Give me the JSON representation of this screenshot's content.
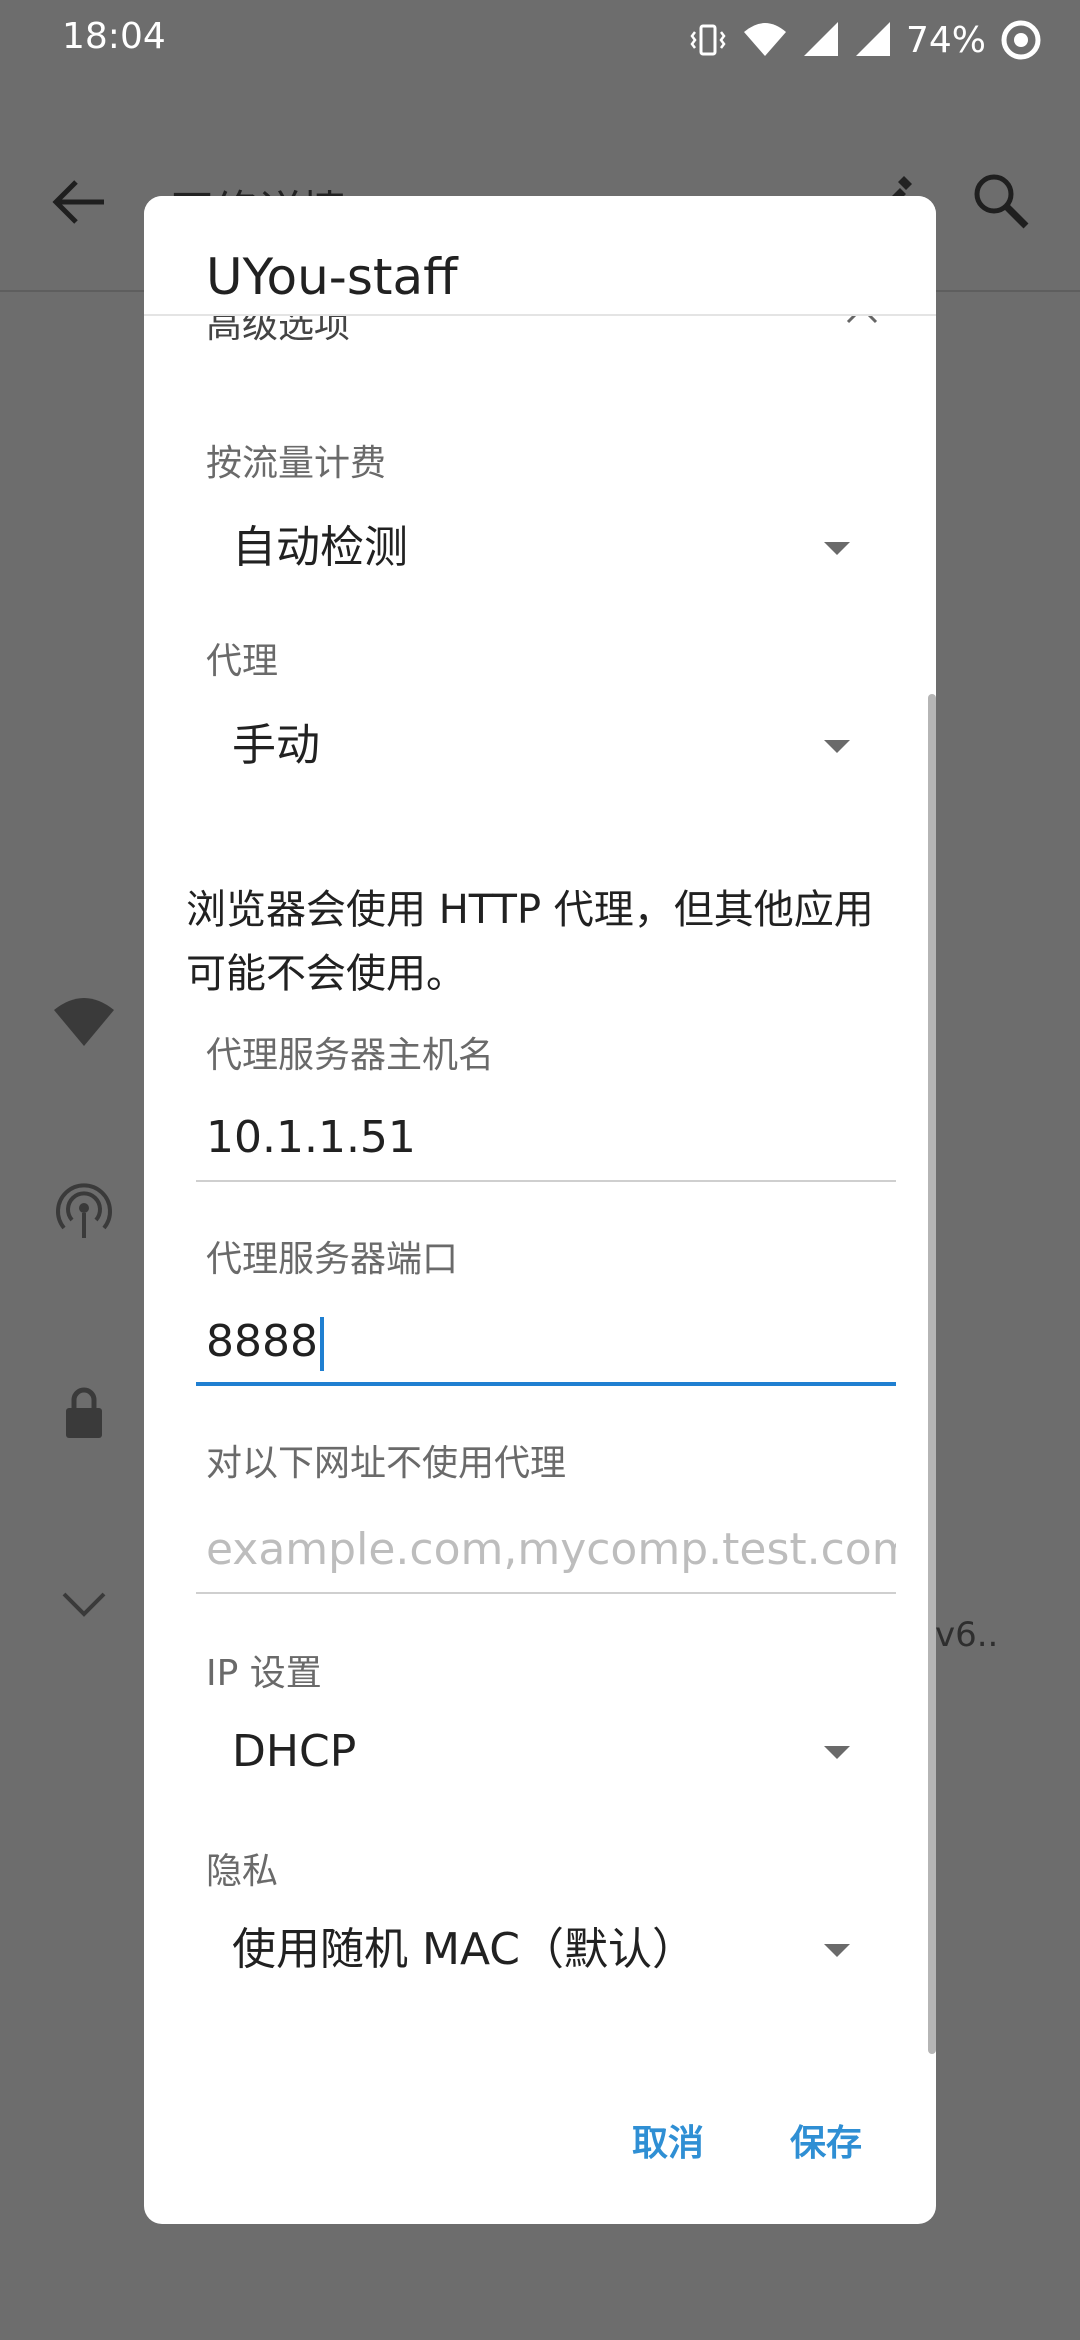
{
  "status_bar": {
    "time": "18:04",
    "battery_percent": "74%",
    "icons": [
      "vibrate-icon",
      "wifi-icon",
      "signal-icon",
      "signal-icon",
      "battery-ring-icon"
    ]
  },
  "background": {
    "title": "网络详情",
    "partial_text": "v6.."
  },
  "dialog": {
    "title": "UYou-staff",
    "advanced_label": "高级选项",
    "metered": {
      "label": "按流量计费",
      "value": "自动检测"
    },
    "proxy": {
      "label": "代理",
      "value": "手动"
    },
    "note": "浏览器会使用 HTTP 代理，但其他应用可能不会使用。",
    "hostname": {
      "label": "代理服务器主机名",
      "value": "10.1.1.51"
    },
    "port": {
      "label": "代理服务器端口",
      "value": "8888"
    },
    "bypass": {
      "label": "对以下网址不使用代理",
      "placeholder": "example.com,mycomp.test.com,l"
    },
    "ip": {
      "label": "IP 设置",
      "value": "DHCP"
    },
    "privacy": {
      "label": "隐私",
      "value": "使用随机 MAC（默认）"
    },
    "cancel_label": "取消",
    "save_label": "保存"
  },
  "colors": {
    "accent": "#1f7fd1",
    "scrim": "#6d6d6d"
  }
}
